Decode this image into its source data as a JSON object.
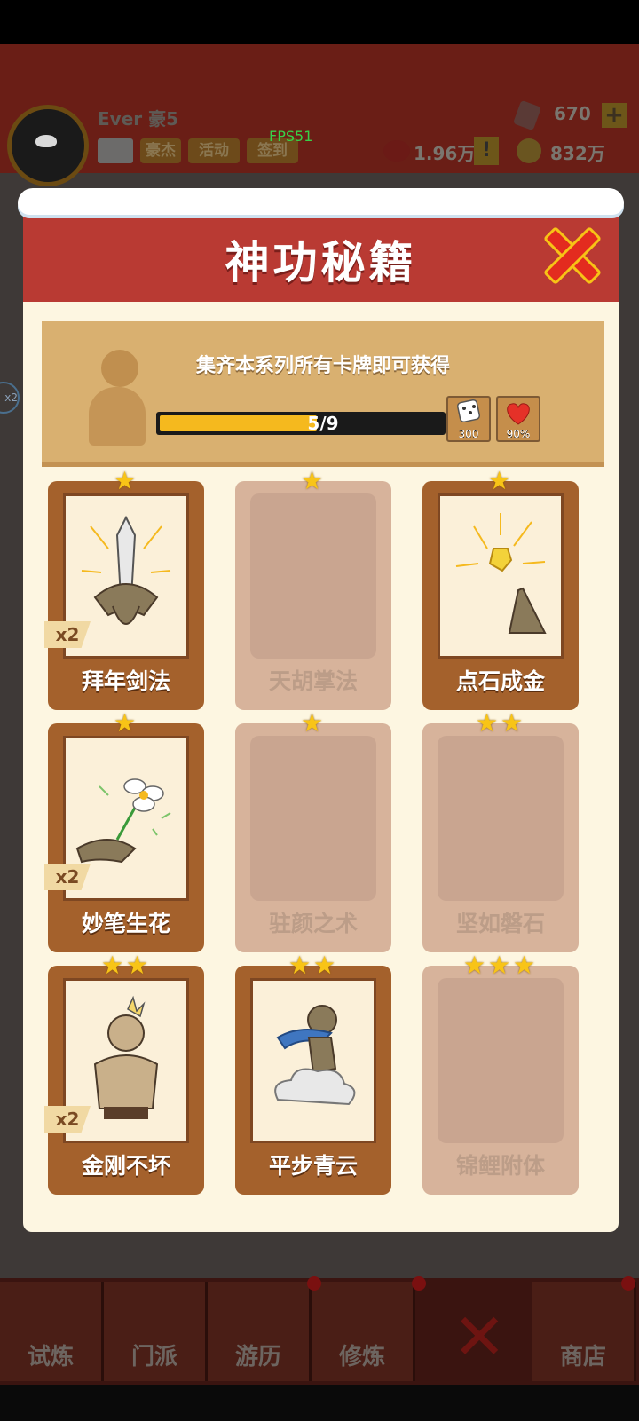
{
  "background_ui": {
    "player_name": "Ever 豪5",
    "buttons": [
      "豪杰",
      "活动",
      "签到"
    ],
    "fps": "FPS51",
    "gems": "670",
    "power": "1.96万",
    "coins": "832万",
    "side_badge": "x2"
  },
  "modal": {
    "title": "神功秘籍",
    "description": "集齐本系列所有卡牌即可获得",
    "progress": {
      "text": "5/9",
      "collected": 5,
      "total": 9
    },
    "rewards": [
      {
        "icon": "dice-icon",
        "value": "300"
      },
      {
        "icon": "heart-icon",
        "value": "90%"
      }
    ]
  },
  "cards": [
    {
      "name": "拜年剑法",
      "stars": 1,
      "owned": true,
      "count": "x2",
      "icon": "sword-icon"
    },
    {
      "name": "天胡掌法",
      "stars": 1,
      "owned": false,
      "count": "",
      "icon": ""
    },
    {
      "name": "点石成金",
      "stars": 1,
      "owned": true,
      "count": "",
      "icon": "gold-finger-icon"
    },
    {
      "name": "妙笔生花",
      "stars": 1,
      "owned": true,
      "count": "x2",
      "icon": "flower-hand-icon"
    },
    {
      "name": "驻颜之术",
      "stars": 1,
      "owned": false,
      "count": "",
      "icon": ""
    },
    {
      "name": "坚如磐石",
      "stars": 2,
      "owned": false,
      "count": "",
      "icon": ""
    },
    {
      "name": "金刚不坏",
      "stars": 2,
      "owned": true,
      "count": "x2",
      "icon": "muscle-man-icon"
    },
    {
      "name": "平步青云",
      "stars": 2,
      "owned": true,
      "count": "",
      "icon": "cloud-rider-icon"
    },
    {
      "name": "锦鲤附体",
      "stars": 3,
      "owned": false,
      "count": "",
      "icon": ""
    }
  ],
  "bottom_nav": {
    "tabs": [
      "试炼",
      "门派",
      "游历",
      "修炼",
      "",
      "商店"
    ]
  },
  "colors": {
    "header_red": "#b93a33",
    "card_brown": "#a4612c",
    "locked_card": "#d7b39b",
    "star_gold": "#f8c417",
    "progress_fill": "#f5b91e"
  }
}
